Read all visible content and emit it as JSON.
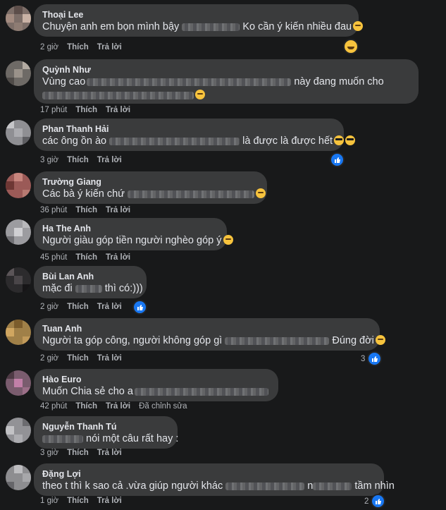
{
  "actions": {
    "like": "Thích",
    "reply": "Trả lời",
    "edited": "Đã chỉnh sửa"
  },
  "comments": [
    {
      "name": "Thoại Lee",
      "line1_a": "Chuyện anh em bọn mình bậy",
      "line1_b": "Ko cần ý kiến nhiều đau",
      "time": "2 giờ"
    },
    {
      "name": "Quỳnh Như",
      "line1_a": "Vùng cao",
      "line1_b": "này đang muốn cho",
      "time": "17 phút"
    },
    {
      "name": "Phan Thanh Hải",
      "line1_a": "các ông ồn ào",
      "line1_b": "là được là được hết",
      "time": "3 giờ"
    },
    {
      "name": "Trường Giang",
      "line1_a": "Các bà ý kiến chứ",
      "time": "36 phút"
    },
    {
      "name": "Ha The Anh",
      "line1_a": "Người giàu góp tiền người nghèo góp ý",
      "time": "45 phút"
    },
    {
      "name": "Bùi Lan Anh",
      "line1_a": "mặc đi",
      "line1_b": "thì có:)))",
      "time": "2 giờ"
    },
    {
      "name": "Tuan Anh",
      "line1_a": "Người ta góp công, người không góp gì",
      "line1_b": "Đúng đời",
      "time": "2 giờ",
      "reaction_count": "3"
    },
    {
      "name": "Hào Euro",
      "line1_a": "Muốn Chia sẻ cho a",
      "time": "42 phút"
    },
    {
      "name": "Nguyễn Thanh Tú",
      "line1_b": "nói một câu rất hay :",
      "time": "3 giờ"
    },
    {
      "name": "Đặng Lợi",
      "line1_a": "theo t thì k sao cả .vừa giúp người khác",
      "line1_b": "tầm nhìn",
      "line1_n": "n",
      "time": "1 giờ",
      "reaction_count": "2"
    }
  ],
  "icons": {
    "like": "like-icon",
    "haha": "haha-icon",
    "emoji": "emoji-icon"
  },
  "colors": {
    "background": "#18191a",
    "bubble": "#3a3b3c",
    "text": "#e4e6eb",
    "meta": "#b0b3b8",
    "like_blue": "#1877f2"
  }
}
